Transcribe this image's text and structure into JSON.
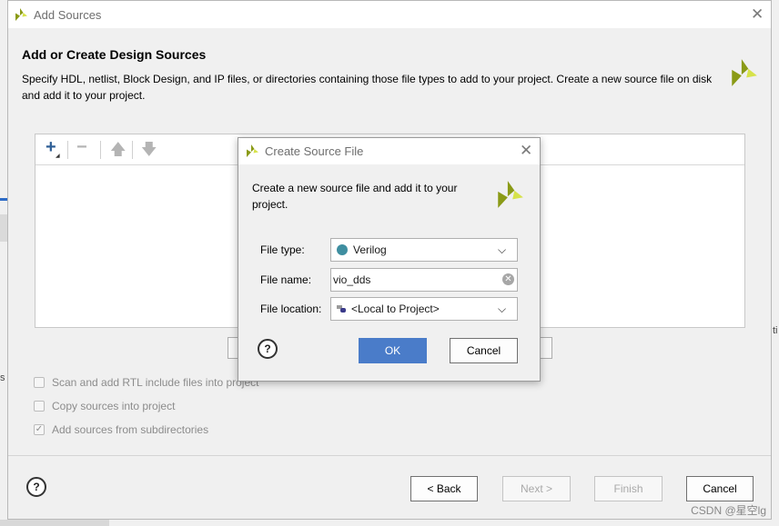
{
  "window": {
    "title": "Add Sources",
    "heading": "Add or Create Design Sources",
    "description": "Specify HDL, netlist, Block Design, and IP files, or directories containing those file types to add to your project. Create a new source file on disk and add it to your project."
  },
  "options": {
    "scan_rtl": {
      "label": "Scan and add RTL include files into project",
      "checked": false
    },
    "copy_sources": {
      "label": "Copy sources into project",
      "checked": false
    },
    "add_subdirs": {
      "label": "Add sources from subdirectories",
      "checked": true
    }
  },
  "footer": {
    "back": "< Back",
    "next": "Next >",
    "finish": "Finish",
    "cancel": "Cancel"
  },
  "dialog": {
    "title": "Create Source File",
    "description": "Create a new source file and add it to your project.",
    "file_type_label": "File type:",
    "file_type_value": "Verilog",
    "file_name_label": "File name:",
    "file_name_value": "vio_dds",
    "file_location_label": "File location:",
    "file_location_value": "<Local to Project>",
    "ok": "OK",
    "cancel": "Cancel"
  },
  "watermark": "CSDN @星空lg",
  "colors": {
    "accent": "#4a7cc9",
    "logo_dark": "#8a9a16",
    "logo_light": "#d6e24a",
    "verilog_dot": "#3e8ea0"
  }
}
